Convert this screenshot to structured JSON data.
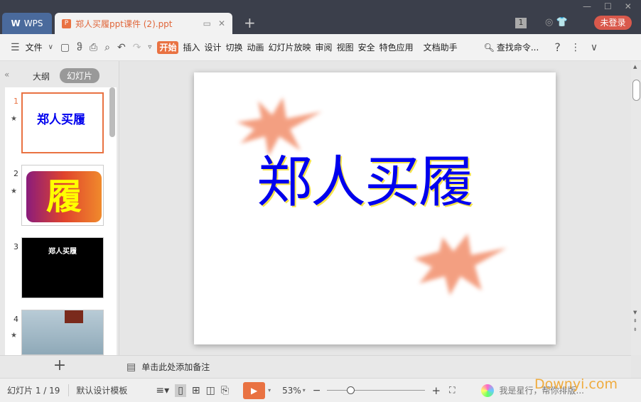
{
  "titlebar": {
    "app_tab": "WPS",
    "doc_tab": "郑人买履ppt课件 (2).ppt",
    "badge": "1",
    "login": "未登录"
  },
  "toolbar": {
    "file": "文件",
    "tabs": [
      "开始",
      "插入",
      "设计",
      "切换",
      "动画",
      "幻灯片放映",
      "审阅",
      "视图",
      "安全",
      "特色应用",
      "文档助手"
    ],
    "search": "查找命令..."
  },
  "left_panel": {
    "tabs": [
      "大纲",
      "幻灯片"
    ],
    "slides": [
      {
        "num": "1",
        "title": "郑人买履"
      },
      {
        "num": "2",
        "title": "履"
      },
      {
        "num": "3",
        "title": "郑人买履"
      },
      {
        "num": "4"
      }
    ]
  },
  "slide": {
    "title": "郑人买履",
    "title_color": "#0000ee"
  },
  "notes": {
    "placeholder": "单击此处添加备注"
  },
  "status": {
    "slide_count": "幻灯片 1 / 19",
    "template": "默认设计模板",
    "zoom": "53%",
    "assistant": "我是星行，帮你排版...",
    "watermark": "Downyi.com",
    "zoom_level_percent": 53
  },
  "colors": {
    "accent": "#e97242",
    "titlebar": "#3b3f4b"
  }
}
